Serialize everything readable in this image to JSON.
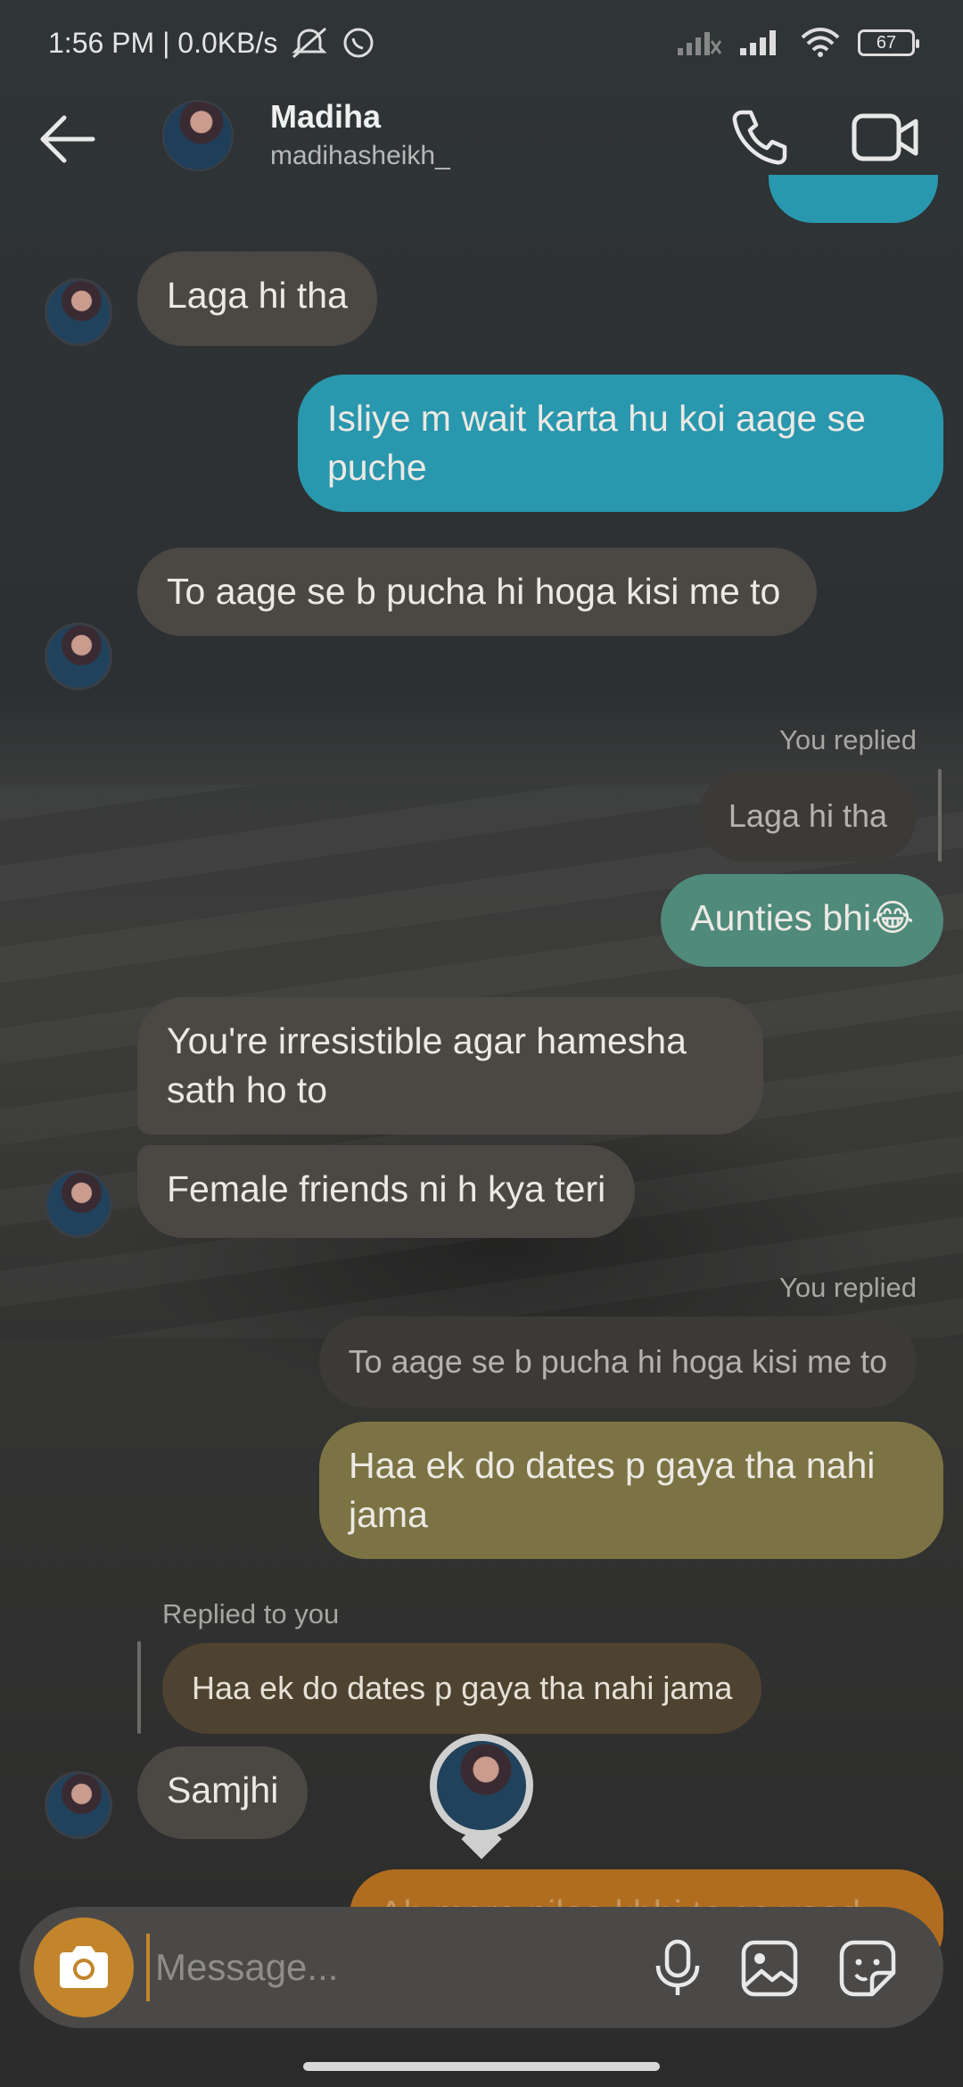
{
  "status_bar": {
    "time_speed": "1:56 PM | 0.0KB/s",
    "battery": "67"
  },
  "header": {
    "name": "Madiha",
    "username": "madihasheikh_"
  },
  "messages": [
    {
      "text": "Laga hi tha"
    },
    {
      "text": "Isliye m wait karta hu koi aage se puche"
    },
    {
      "text": "To aage se b pucha hi hoga kisi me to"
    },
    {
      "reply_label": "You replied",
      "quote": "Laga hi tha",
      "text": "Aunties bhi😂"
    },
    {
      "text": "You're irresistible agar hamesha sath ho to"
    },
    {
      "text": "Female friends ni h kya teri"
    },
    {
      "reply_label": "You replied",
      "quote": "To aage se b pucha hi hoga kisi me to",
      "text": "Haa ek do dates p gaya tha nahi jama"
    },
    {
      "reply_label": "Replied to you",
      "quote": "Haa ek do dates p gaya tha nahi jama",
      "text": "Samjhi"
    },
    {
      "text": "Ab mere pilaa kbhi to se yaad"
    }
  ],
  "composer": {
    "placeholder": "Message..."
  },
  "colors": {
    "incoming": "#4b4844",
    "outgoing_teal": "#2997ad",
    "outgoing_green": "#4f8a7a",
    "outgoing_olive": "#7c7344",
    "outgoing_orange": "#b06d20",
    "camera": "#c2852b"
  },
  "icons": [
    "back-arrow-icon",
    "phone-icon",
    "video-camera-icon",
    "camera-icon",
    "mic-icon",
    "gallery-icon",
    "sticker-icon",
    "mute-icon",
    "whatsapp-icon",
    "signal-icon",
    "wifi-icon"
  ]
}
